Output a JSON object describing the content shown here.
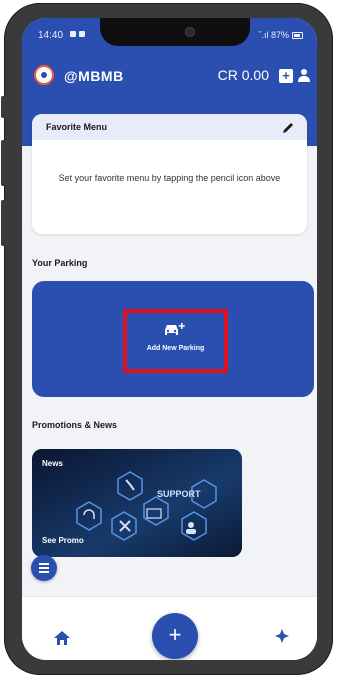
{
  "status_bar": {
    "time": "14:40",
    "signal_battery": "ˇ.ıl 87%"
  },
  "header": {
    "username": "@MBMB",
    "balance": "CR 0.00",
    "add_icon": "plus-square-icon",
    "profile_icon": "person-icon",
    "accent": "#2b4fb1"
  },
  "favorite_menu": {
    "title": "Favorite Menu",
    "empty_text": "Set your favorite menu by tapping the pencil icon above",
    "edit_icon": "pencil-icon"
  },
  "parking": {
    "section_title": "Your Parking",
    "add_label": "Add New Parking",
    "add_icon": "car-add-icon",
    "highlight_color": "#e0101e"
  },
  "promotions": {
    "section_title": "Promotions & News",
    "card_label": "News",
    "card_action": "See Promo",
    "image_text": "SUPPORT"
  },
  "bottom_nav": {
    "home_icon": "home-icon",
    "center_label": "+",
    "right_icon": "compass-icon"
  },
  "floating_menu_icon": "menu-icon"
}
